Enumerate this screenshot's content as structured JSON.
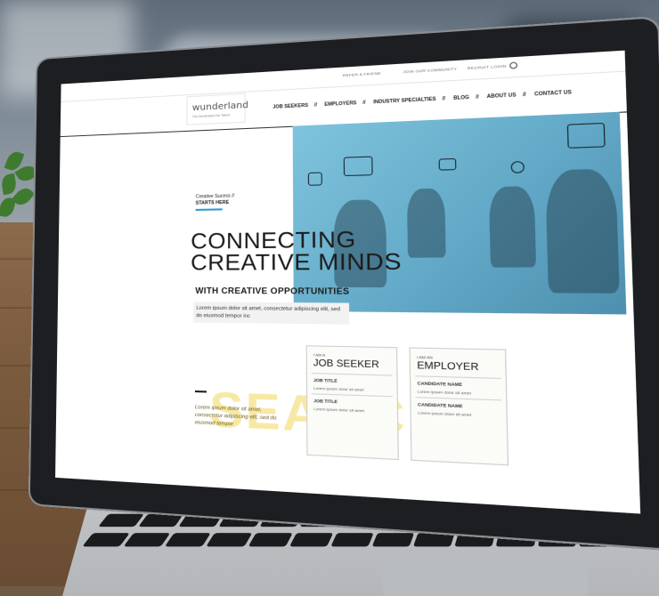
{
  "site": {
    "logo": "wunderland",
    "logo_tagline": "The Destination for Talent",
    "top_links": [
      "REFER A FRIEND",
      "JOIN OUR COMMUNITY",
      "RECRUIT LOGIN"
    ],
    "nav": [
      "JOB SEEKERS",
      "EMPLOYERS",
      "INDUSTRY SPECIALTIES",
      "BLOG",
      "ABOUT US",
      "CONTACT US"
    ],
    "nav_separator": "//"
  },
  "hero": {
    "tag_line_1": "Creative Sucess //",
    "tag_line_2": "STARTS HERE",
    "headline_line_1": "CONNECTING",
    "headline_line_2": "CREATIVE MINDS",
    "subheadline": "WITH CREATIVE OPPORTUNITIES",
    "body": "Lorem ipsum dolor sit amet, consectetur adipiscing elit, sed do eiusmod tempor inc"
  },
  "search_section": {
    "watermark": "SEARCH",
    "intro": "Lorem ipsum dolor sit amet, consectetur adipiscing elit, sed do eiusmod tempor"
  },
  "panels": [
    {
      "kicker": "I AM A",
      "title": "JOB SEEKER",
      "rows": [
        {
          "label": "JOB TITLE",
          "text": "Lorem ipsum dolor sit amet"
        },
        {
          "label": "JOB TITLE",
          "text": "Lorem ipsum dolor sit amet"
        }
      ]
    },
    {
      "kicker": "I AM AN",
      "title": "EMPLOYER",
      "rows": [
        {
          "label": "CANDIDATE NAME",
          "text": "Lorem ipsum dolor sit amet"
        },
        {
          "label": "CANDIDATE NAME",
          "text": "Lorem ipsum dolor sit amet"
        }
      ]
    }
  ],
  "colors": {
    "accent": "#2a9bd1",
    "hero_blue": "#63aac8",
    "watermark_yellow": "#f7e9a4"
  }
}
